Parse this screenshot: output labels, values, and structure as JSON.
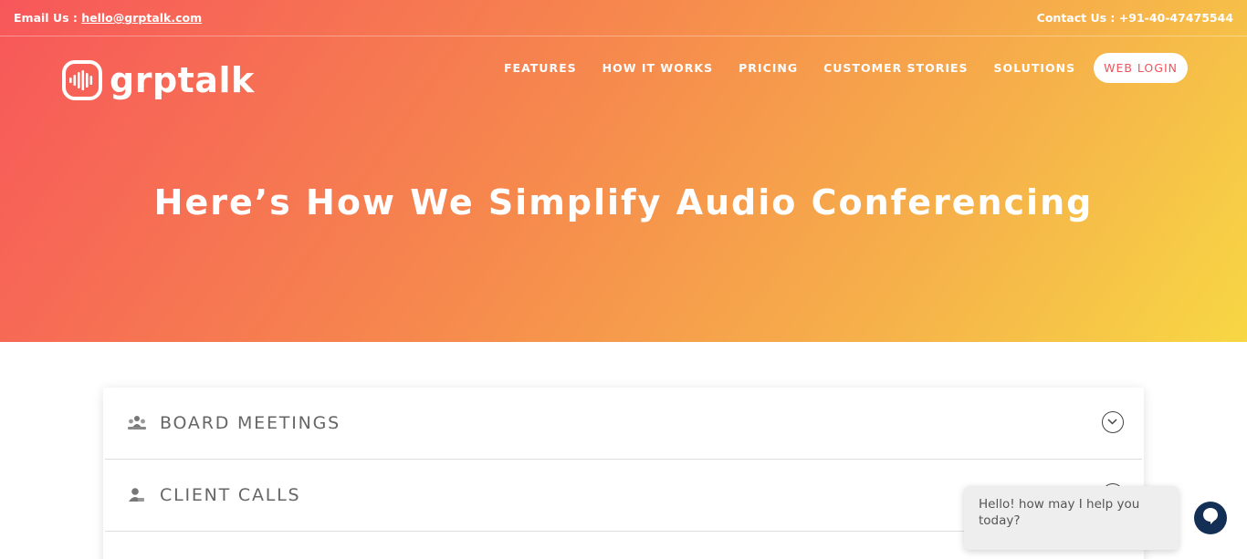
{
  "topbar": {
    "email_prefix": "Email Us : ",
    "email": "hello@grptalk.com",
    "contact": "Contact Us : +91-40-47475544"
  },
  "logo": {
    "text": "grptalk",
    "icon": "sound-wave-logo-icon"
  },
  "nav": {
    "items": [
      "FEATURES",
      "HOW IT WORKS",
      "PRICING",
      "CUSTOMER STORIES",
      "SOLUTIONS"
    ],
    "login": "WEB LOGIN"
  },
  "hero": {
    "title": "Here’s How We Simplify Audio Conferencing"
  },
  "accordion": {
    "items": [
      {
        "label": "BOARD MEETINGS",
        "icon": "meeting-group-icon"
      },
      {
        "label": "CLIENT CALLS",
        "icon": "client-person-icon"
      }
    ]
  },
  "chat": {
    "message": "Hello! how may I help you today?",
    "icon": "chat-bubble-icon"
  },
  "colors": {
    "gradient_start": "#f7575a",
    "gradient_end": "#f7d744",
    "login_text": "#f0535a",
    "chat_button": "#142f55"
  }
}
